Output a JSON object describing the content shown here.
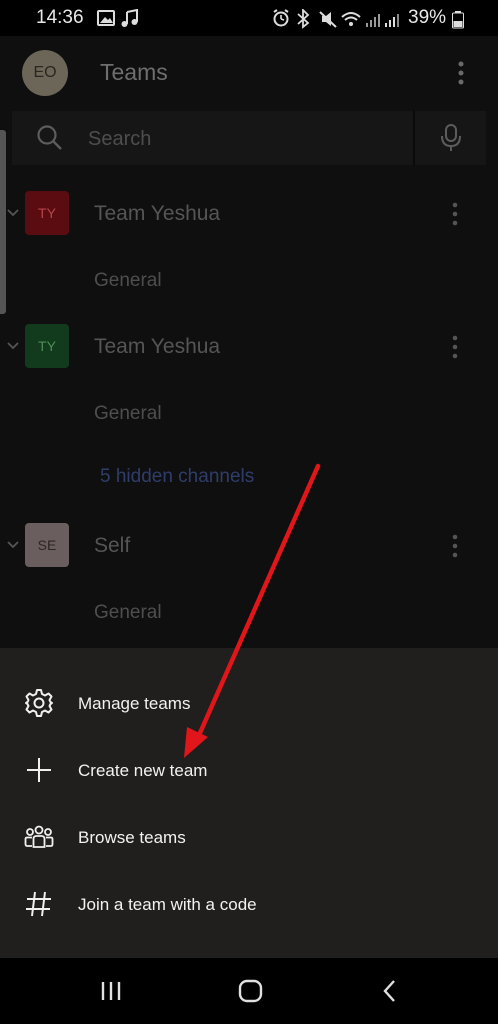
{
  "status_bar": {
    "time": "14:36",
    "battery": "39%"
  },
  "header": {
    "avatar_initials": "EO",
    "title": "Teams"
  },
  "search": {
    "placeholder": "Search"
  },
  "teams": [
    {
      "initials": "TY",
      "name": "Team Yeshua",
      "color": "#5a0c11",
      "text_color": "#b5454a",
      "channels": [
        "General"
      ]
    },
    {
      "initials": "TY",
      "name": "Team Yeshua",
      "color": "#123a1c",
      "text_color": "#4d8c57",
      "channels": [
        "General"
      ],
      "hidden_channels": "5 hidden channels"
    },
    {
      "initials": "SE",
      "name": "Self",
      "color": "#6a5f5e",
      "text_color": "#2c2625",
      "channels": [
        "General"
      ]
    }
  ],
  "sheet": {
    "items": [
      {
        "label": "Manage teams",
        "icon": "gear-icon"
      },
      {
        "label": "Create new team",
        "icon": "plus-icon"
      },
      {
        "label": "Browse teams",
        "icon": "people-icon"
      },
      {
        "label": "Join a team with a code",
        "icon": "hashtag-icon"
      }
    ]
  },
  "colors": {
    "sheet_bg": "#201f1d",
    "annotation_arrow": "#e0161a"
  }
}
